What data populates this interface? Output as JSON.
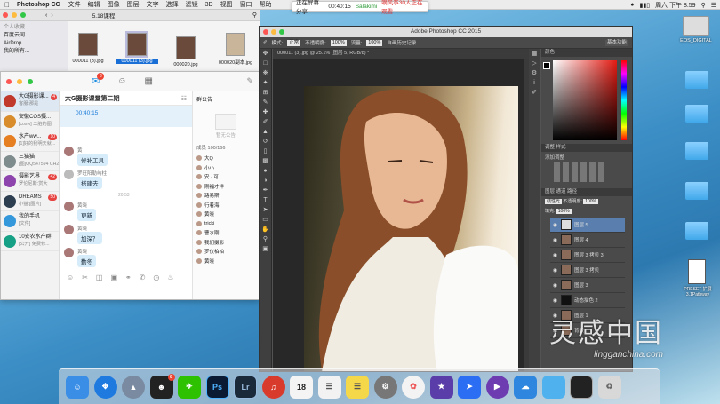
{
  "menubar": {
    "app": "Photoshop CC",
    "menus": [
      "文件",
      "编辑",
      "图像",
      "图层",
      "文字",
      "选择",
      "滤镜",
      "3D",
      "视图",
      "窗口",
      "帮助"
    ],
    "clock": "周六 下午 8:59"
  },
  "recording": {
    "status": "正在屏幕分享",
    "time": "00:40:15",
    "user": "Salakimi",
    "tip": "嘀风筝30人正在观看"
  },
  "finder": {
    "path": "5.18课程",
    "sidebar": [
      "个人收藏",
      "百度云同...",
      "AirDrop",
      "我的所有..."
    ],
    "files": [
      {
        "name": "000011 (3).jpg"
      },
      {
        "name": "000011 (3).jpg"
      },
      {
        "name": "000020.jpg"
      },
      {
        "name": "000020副本.jpg"
      }
    ]
  },
  "qq": {
    "unread": "8",
    "conversations": [
      {
        "name": "大G摄影课...",
        "preview": "客服:那是",
        "badge": "4",
        "color": "#c0392b"
      },
      {
        "name": "安徽COS摄...",
        "preview": "[cosw] 二脏的图",
        "badge": "",
        "color": "#d98c2b"
      },
      {
        "name": "水产ww...",
        "preview": "[1]好的我明天就...",
        "badge": "10",
        "color": "#e67e22"
      },
      {
        "name": "三猫猫",
        "preview": "[图]QQ547594 CH2",
        "badge": "",
        "color": "#7f8c8d"
      },
      {
        "name": "摄影艺界",
        "preview": "罗伦尼斯:赏大",
        "badge": "42",
        "color": "#8e44ad"
      },
      {
        "name": "DREAMS",
        "preview": "小猫:[图片]",
        "badge": "50",
        "color": "#2c3e50"
      },
      {
        "name": "我的手机",
        "preview": "[文件]",
        "badge": "",
        "color": "#3498db"
      },
      {
        "name": "10安农水产群",
        "preview": "[公开] 免费修...",
        "badge": "",
        "color": "#16a085"
      }
    ],
    "chat": {
      "title": "大G摄影课堂第二期",
      "timer": "00:40:15",
      "messages": [
        {
          "sender": "黄",
          "text": "修补工具"
        },
        {
          "sender": "罗旺阳勒屿柱",
          "text": "搭建去"
        },
        {
          "sender": "黄晓",
          "text": "更新"
        },
        {
          "sender": "黄晓",
          "text": "加深？"
        },
        {
          "sender": "黄晓",
          "text": "勤冬"
        }
      ],
      "time_tag": "20:53"
    },
    "members": {
      "notice_label": "群公告",
      "empty_label": "暂无公告",
      "count_label": "成员 100/166",
      "list": [
        "大Q",
        "小小",
        "安 · 可",
        "刚福才洋",
        "路易斯",
        "行着海",
        "黄晓",
        "tricki",
        "曹水刚",
        "我们摄影",
        "罗仪柏柏",
        "黄晓"
      ]
    }
  },
  "photoshop": {
    "title": "Adobe Photoshop CC 2015",
    "doc_tab": "000011 (3).jpg @ 25.1% (图层 5, RGB/8) *",
    "options": {
      "mode_label": "模式:",
      "mode": "正常",
      "opacity_label": "不透明度:",
      "opacity": "100%",
      "flow_label": "流量:",
      "flow": "100%",
      "history": "自画历史记录",
      "workspace": "基本功能"
    },
    "panels": {
      "color_tab": "颜色",
      "adjust_tab": "调整",
      "style_tab": "样式",
      "add_adjust": "添加调整",
      "layers_tab": "图层",
      "channels_tab": "通道",
      "paths_tab": "路径",
      "blend": "线性光",
      "opacity_label": "不透明度:",
      "opacity": "100%",
      "fill_label": "填充:",
      "fill": "100%",
      "layers": [
        "图层 5",
        "图层 4",
        "图层 3 拷贝 3",
        "图层 3 拷贝",
        "图层 3",
        "动态描色 2",
        "图层 1",
        "背景"
      ]
    }
  },
  "desktop": {
    "icons": [
      "EOS_DIGITAL",
      "",
      "",
      "",
      "",
      "",
      "PRESET 扩展 3.1Pathway"
    ]
  },
  "watermark": {
    "main": "灵感中国",
    "sub": "lingganchina.com"
  },
  "dock": {
    "items": [
      {
        "name": "finder",
        "color": "#3a8ee6",
        "label": ""
      },
      {
        "name": "safari",
        "color": "#1f7ae0",
        "label": ""
      },
      {
        "name": "launchpad",
        "color": "#7a8aa0",
        "label": ""
      },
      {
        "name": "qq",
        "color": "#222",
        "label": "",
        "badge": "8"
      },
      {
        "name": "wechat",
        "color": "#2dc100",
        "label": ""
      },
      {
        "name": "photoshop",
        "color": "#0a1a33",
        "label": "Ps"
      },
      {
        "name": "lightroom",
        "color": "#1b2a3a",
        "label": "Lr"
      },
      {
        "name": "netease-music",
        "color": "#d83b2c",
        "label": ""
      },
      {
        "name": "calendar",
        "color": "#f4f4f4",
        "label": "18"
      },
      {
        "name": "reminders",
        "color": "#f2f2f2",
        "label": ""
      },
      {
        "name": "notes",
        "color": "#f5d84a",
        "label": ""
      },
      {
        "name": "system-prefs",
        "color": "#777",
        "label": ""
      },
      {
        "name": "photos",
        "color": "#f3f3f3",
        "label": ""
      },
      {
        "name": "imovie",
        "color": "#5a3da8",
        "label": ""
      },
      {
        "name": "feishu",
        "color": "#2b6ef3",
        "label": ""
      },
      {
        "name": "media-player",
        "color": "#6c3cb0",
        "label": ""
      },
      {
        "name": "baidu-cloud",
        "color": "#2e86de",
        "label": ""
      },
      {
        "name": "folder",
        "color": "#4fb2ee",
        "label": ""
      },
      {
        "name": "screen",
        "color": "#222",
        "label": ""
      },
      {
        "name": "trash",
        "color": "#d8d8d8",
        "label": ""
      }
    ]
  }
}
